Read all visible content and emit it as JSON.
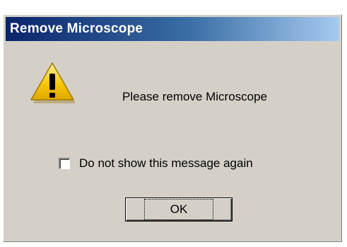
{
  "window": {
    "title": "Remove Microscope"
  },
  "dialog": {
    "icon": "warning-icon",
    "message": "Please remove Microscope",
    "checkbox_label": "Do not show this message again",
    "checkbox_checked": false,
    "ok_label": "OK"
  },
  "colors": {
    "titlebar_start": "#0a246a",
    "titlebar_end": "#a6caf0",
    "dialog_background": "#d4d0c8",
    "warning_yellow": "#f5c400"
  }
}
